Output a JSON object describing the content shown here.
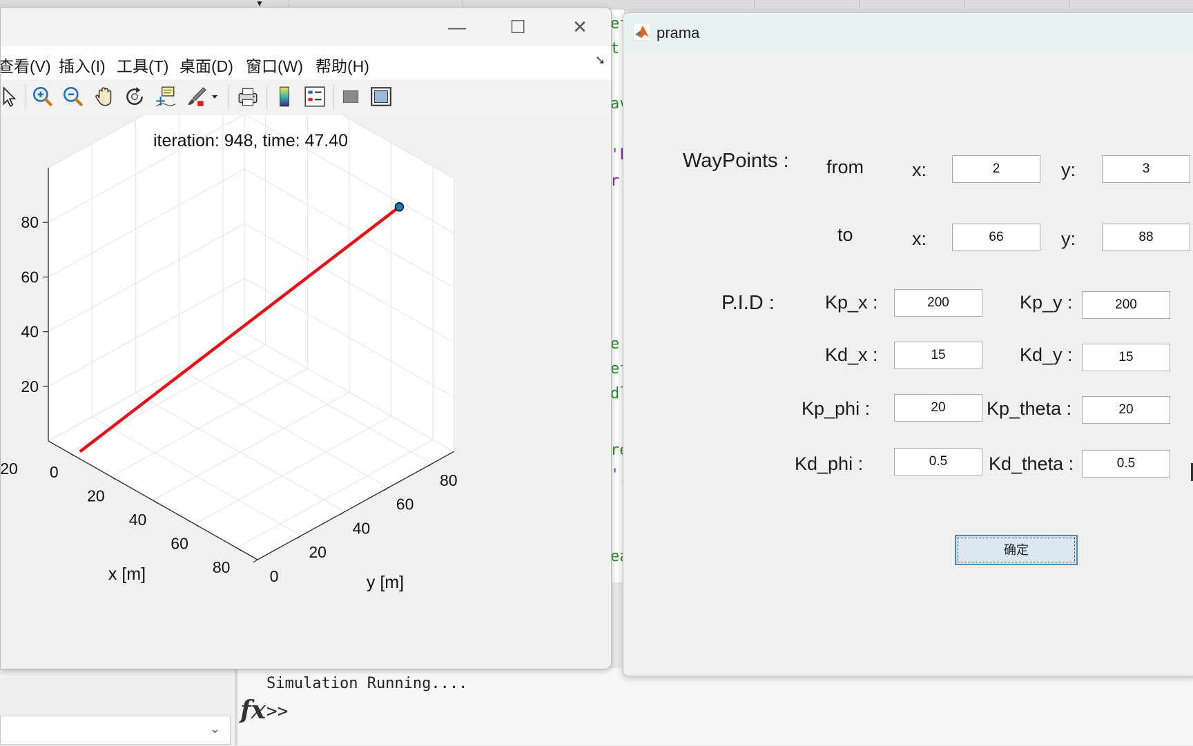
{
  "figure": {
    "menu": [
      "查看(V)",
      "插入(I)",
      "工具(T)",
      "桌面(D)",
      "窗口(W)",
      "帮助(H)"
    ],
    "toolbar_icons": [
      "arrow-icon",
      "zoom-in-icon",
      "zoom-out-icon",
      "pan-icon",
      "rotate-3d-icon",
      "data-cursor-icon",
      "brush-icon",
      "brush-dropdown-icon",
      "print-icon",
      "colorbar-icon",
      "legend-icon",
      "hide-plot-tools-icon",
      "show-plot-tools-icon"
    ],
    "window_buttons": [
      "minimize-icon",
      "maximize-icon",
      "close-icon"
    ]
  },
  "chart_data": {
    "type": "line",
    "title": "iteration: 948, time: 47.40",
    "xlabel": "x [m]",
    "ylabel": "y [m]",
    "x_ticks": [
      "0",
      "20",
      "40",
      "60",
      "80"
    ],
    "y_ticks": [
      "0",
      "20",
      "40",
      "60",
      "80"
    ],
    "z_ticks_partial": [
      "20",
      "20",
      "40",
      "60",
      "80"
    ],
    "x_tick_prefix": "20",
    "grid": true,
    "line_color": "#e0151b",
    "marker_color": "#1f77b4",
    "series": [
      {
        "x": [
          2,
          66
        ],
        "y": [
          3,
          88
        ],
        "z": [
          0,
          80
        ]
      }
    ]
  },
  "prama": {
    "title": "prama",
    "waypoints_label": "WayPoints :",
    "from_label": "from",
    "to_label": "to",
    "x_label": "x:",
    "y_label": "y:",
    "from_x": "2",
    "from_y": "3",
    "to_x": "66",
    "to_y": "88",
    "pid_label": "P.I.D :",
    "kp_x_label": "Kp_x :",
    "kp_y_label": "Kp_y :",
    "kd_x_label": "Kd_x :",
    "kd_y_label": "Kd_y :",
    "kp_phi_label": "Kp_phi :",
    "kp_theta_label": "Kp_theta :",
    "kd_phi_label": "Kd_phi :",
    "kd_theta_label": "Kd_theta :",
    "kp_x": "200",
    "kp_y": "200",
    "kd_x": "15",
    "kd_y": "15",
    "kp_phi": "20",
    "kp_theta": "20",
    "kd_phi": "0.5",
    "kd_theta": "0.5",
    "ok_label": "确定"
  },
  "command": {
    "output": "Simulation Running....",
    "prompt": ">>",
    "fx": "fx"
  },
  "editor_fragments": [
    "ef",
    "t",
    "av",
    "'F",
    "r'",
    "e",
    "ef",
    "dl",
    "re",
    "',",
    "ea"
  ]
}
